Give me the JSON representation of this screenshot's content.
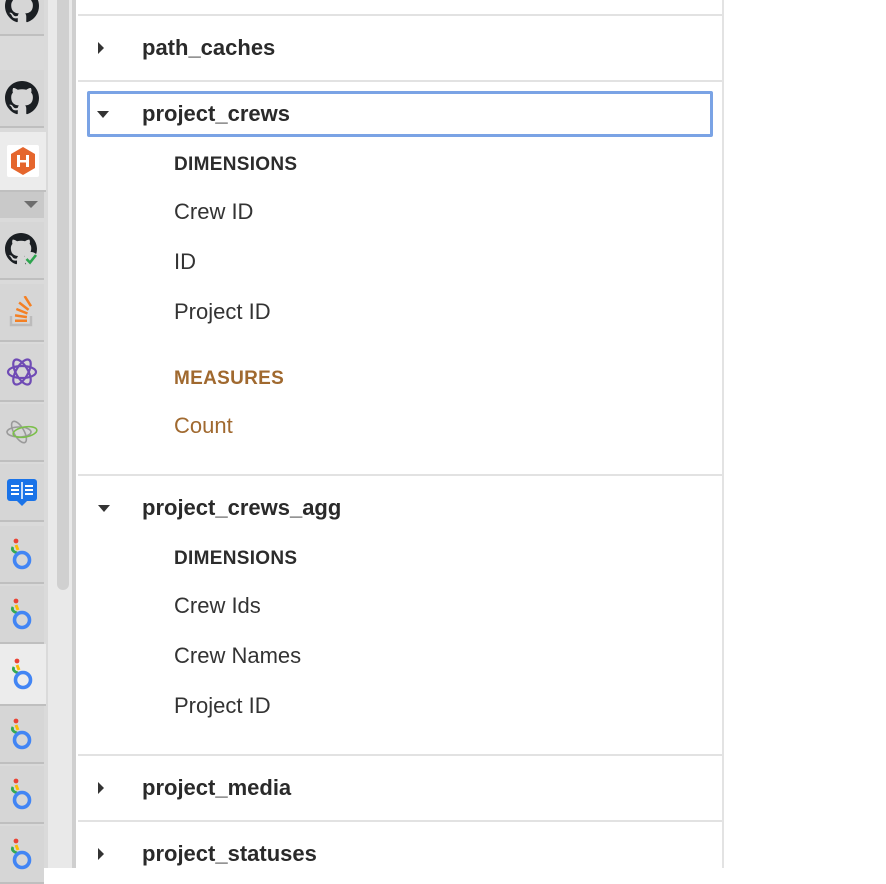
{
  "tabstrip": {
    "icons": [
      {
        "name": "github-icon"
      },
      {
        "name": "github-icon"
      },
      {
        "name": "hound-ci-icon"
      },
      {
        "name": "github-check-icon"
      },
      {
        "name": "stack-overflow-icon"
      },
      {
        "name": "graphql-icon"
      },
      {
        "name": "graphql-colored-icon"
      },
      {
        "name": "reader-book-icon"
      },
      {
        "name": "looker-icon"
      },
      {
        "name": "looker-icon"
      },
      {
        "name": "looker-icon"
      },
      {
        "name": "looker-icon"
      },
      {
        "name": "looker-icon"
      },
      {
        "name": "looker-icon"
      }
    ]
  },
  "explorer": {
    "views": [
      {
        "label": "path_caches",
        "expanded": false
      },
      {
        "label": "project_crews",
        "expanded": true,
        "focused": true,
        "dimensions_header": "DIMENSIONS",
        "dimensions": [
          "Crew ID",
          "ID",
          "Project ID"
        ],
        "measures_header": "MEASURES",
        "measures": [
          "Count"
        ]
      },
      {
        "label": "project_crews_agg",
        "expanded": true,
        "dimensions_header": "DIMENSIONS",
        "dimensions": [
          "Crew Ids",
          "Crew Names",
          "Project ID"
        ]
      },
      {
        "label": "project_media",
        "expanded": false
      },
      {
        "label": "project_statuses",
        "expanded": false
      }
    ]
  },
  "colors": {
    "focus_outline": "#7aa3e5",
    "measure_text": "#a0692f",
    "text": "#333333"
  }
}
